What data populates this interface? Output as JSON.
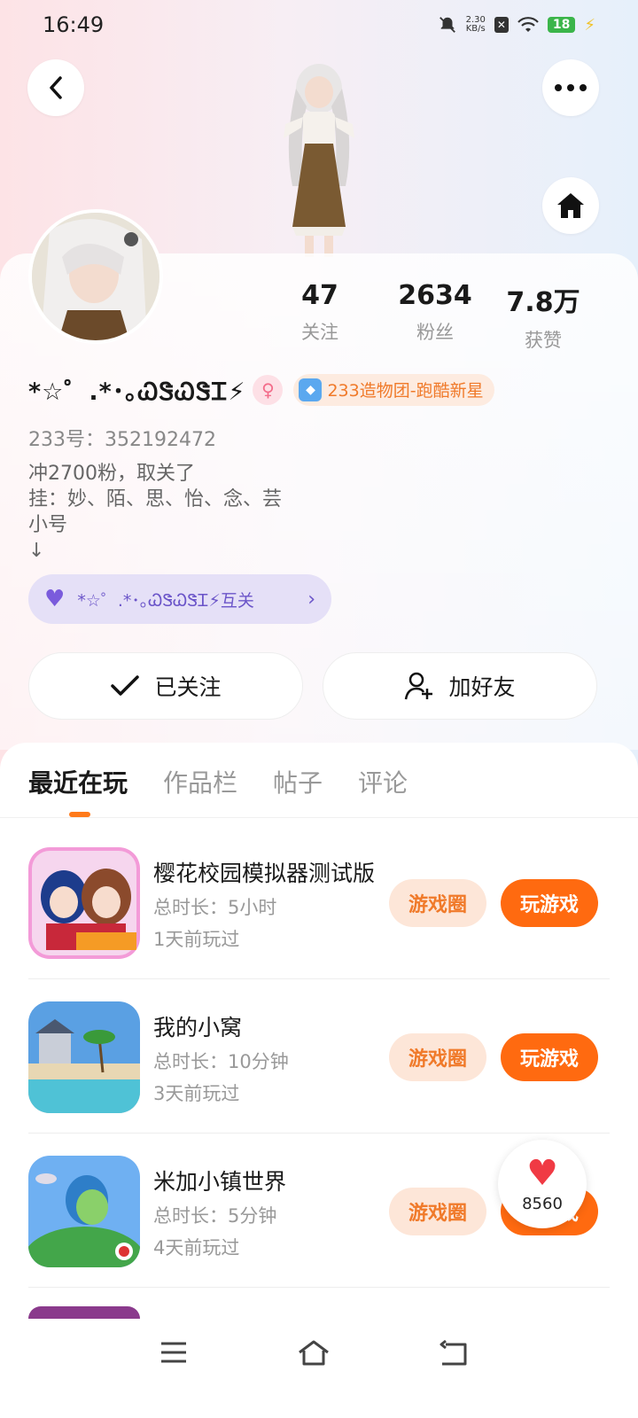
{
  "status_bar": {
    "time": "16:49",
    "net_speed_value": "2.30",
    "net_speed_unit": "KB/s",
    "battery": "18"
  },
  "profile": {
    "nickname": "*☆゜.*･｡ᏇᏕᏇᏕᏆ⚡",
    "group_badge": "233造物团-跑酷新星",
    "uid": "233号：352192472",
    "bio": [
      "冲2700粉，取关了",
      "挂：妙、陌、思、怡、念、芸",
      "小号",
      "↓"
    ],
    "mutual_chip": "*☆゜.*･｡ᏇᏕᏇᏕᏆ⚡互关"
  },
  "stats": [
    {
      "value": "47",
      "label": "关注"
    },
    {
      "value": "2634",
      "label": "粉丝"
    },
    {
      "value": "7.8万",
      "label": "获赞"
    }
  ],
  "actions": {
    "followed": "已关注",
    "add_friend": "加好友"
  },
  "tabs": [
    "最近在玩",
    "作品栏",
    "帖子",
    "评论"
  ],
  "games": [
    {
      "title": "樱花校园模拟器测试版",
      "duration": "总时长：5小时",
      "last_played": "1天前玩过",
      "circle": "游戏圈",
      "play": "玩游戏"
    },
    {
      "title": "我的小窝",
      "duration": "总时长：10分钟",
      "last_played": "3天前玩过",
      "circle": "游戏圈",
      "play": "玩游戏"
    },
    {
      "title": "米加小镇世界",
      "duration": "总时长：5分钟",
      "last_played": "4天前玩过",
      "circle": "游戏圈",
      "play": "玩游戏"
    }
  ],
  "like_float": {
    "count": "8560"
  },
  "colors": {
    "accent": "#ff6a10",
    "purple": "#6b55c9"
  }
}
